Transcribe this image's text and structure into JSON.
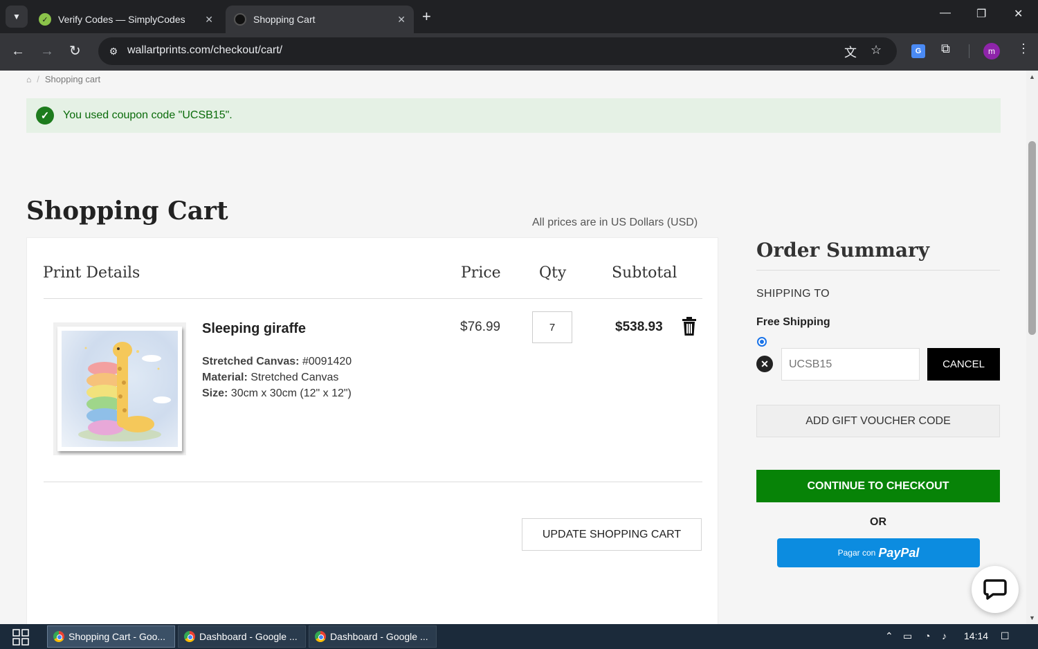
{
  "browser": {
    "tabs": [
      {
        "title": "Verify Codes — SimplyCodes",
        "close": "✕"
      },
      {
        "title": "Shopping Cart",
        "close": "✕"
      }
    ],
    "new_tab": "+",
    "url": "wallartprints.com/checkout/cart/",
    "avatar_letter": "m"
  },
  "breadcrumb": {
    "current": "Shopping cart"
  },
  "alert": {
    "message": "You used coupon code \"UCSB15\"."
  },
  "cart": {
    "title": "Shopping Cart",
    "currency_note": "All prices are in US Dollars (USD)",
    "columns": {
      "details": "Print Details",
      "price": "Price",
      "qty": "Qty",
      "subtotal": "Subtotal"
    },
    "item": {
      "name": "Sleeping giraffe",
      "canvas_label": "Stretched Canvas:",
      "canvas_value": " #0091420",
      "material_label": "Material:",
      "material_value": " Stretched Canvas",
      "size_label": "Size:",
      "size_value": " 30cm x 30cm (12\" x 12\")",
      "price": "$76.99",
      "qty": "7",
      "subtotal": "$538.93"
    },
    "update_button": "UPDATE SHOPPING CART"
  },
  "summary": {
    "title": "Order Summary",
    "shipping_to": "SHIPPING TO",
    "shipping_method": "Free Shipping",
    "coupon_placeholder": "UCSB15",
    "cancel_button": "CANCEL",
    "gift_button": "ADD GIFT VOUCHER CODE",
    "checkout_button": "CONTINUE TO CHECKOUT",
    "or_label": "OR",
    "paypal_prefix": "Pagar con",
    "paypal_logo": "PayPal"
  },
  "taskbar": {
    "tasks": [
      {
        "title": "Shopping Cart - Goo..."
      },
      {
        "title": "Dashboard - Google ..."
      },
      {
        "title": "Dashboard - Google ..."
      }
    ],
    "time": "14:14"
  },
  "colors": {
    "checkout_green": "#078307",
    "alert_bg": "#e5f1e5",
    "paypal_blue": "#0c8ce0"
  }
}
